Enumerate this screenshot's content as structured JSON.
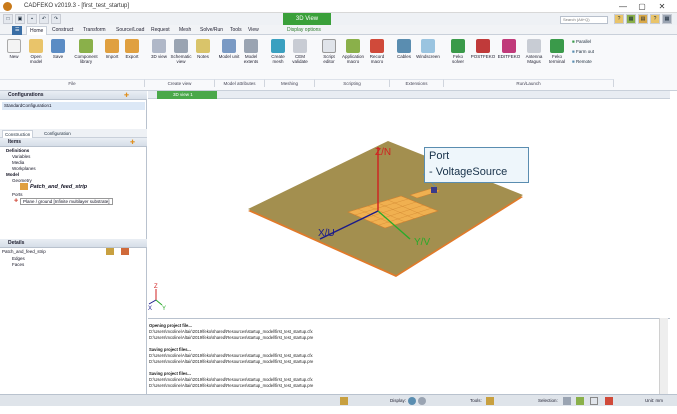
{
  "window": {
    "title": "CADFEKO v2019.3 - [first_test_startup]",
    "controls": [
      "—",
      "▢",
      "✕"
    ]
  },
  "context_tab": "3D View",
  "search": {
    "placeholder": "Search (Alt+Q)"
  },
  "tabs": [
    "Home",
    "Construct",
    "Transform",
    "Source/Load",
    "Request",
    "Mesh",
    "Solve/Run",
    "Tools",
    "View",
    "Display options"
  ],
  "active_tab": "Home",
  "ribbon": {
    "groups": [
      {
        "label": "File",
        "buttons": [
          "New",
          "Open model",
          "Save",
          "Component library",
          "Import",
          "Export"
        ]
      },
      {
        "label": "Create view",
        "buttons": [
          "3D view",
          "Schematic view",
          "Notes"
        ]
      },
      {
        "label": "Model attributes",
        "buttons": [
          "Model unit",
          "Model extents"
        ]
      },
      {
        "label": "Meshing",
        "buttons": [
          "Create mesh",
          "CEM validate"
        ]
      },
      {
        "label": "Scripting",
        "buttons": [
          "Script editor",
          "Application macro",
          "Record macro"
        ]
      },
      {
        "label": "Extensions",
        "buttons": [
          "Cables",
          "Windscreen"
        ]
      },
      {
        "label": "Run/Launch",
        "buttons": [
          "Feko solver",
          "POSTFEKO",
          "EDITFEKO",
          "Antenna Magus",
          "Feko terminal"
        ]
      }
    ],
    "run_small": [
      "Parallel",
      "Farm out",
      "Remote"
    ]
  },
  "left": {
    "configurations_header": "Configurations",
    "configuration_item": "StandardConfiguration1",
    "tabs": [
      "Construction",
      "Configuration"
    ],
    "items_header": "Items",
    "tree": [
      "Definitions",
      "Variables",
      "Media",
      "Workplanes",
      "Model",
      "Geometry",
      "Patch_and_feed_strip",
      "Ports",
      "Plane / ground [Infinite multilayer substrate]"
    ],
    "details_header": "Details",
    "details_selected": "Patch_and_feed_strip",
    "details_items": [
      "Edges",
      "Faces"
    ]
  },
  "doc_tab": "3D view 1",
  "viewport": {
    "axes": {
      "z": "Z/N",
      "x": "X/U",
      "y": "Y/V"
    },
    "triad": {
      "z": "Z",
      "x": "X",
      "y": "Y"
    },
    "port_label_1": "Port",
    "port_label_2": "- VoltageSource",
    "colors": {
      "ground": "#a38f4f",
      "ground_edge": "#e07a2a",
      "patch": "#f0b050",
      "axis_z": "#d02020",
      "axis_x": "#1a1a8a",
      "axis_y": "#2aaa2a",
      "port_box": "#5a8db0"
    }
  },
  "output": [
    {
      "text": "Opening project file...",
      "bold": true
    },
    {
      "text": "D:\\Users\\mcoline\\Altair\\2019\\feko\\shared\\Resources\\startup_model\\first_test_startup.cfx",
      "bold": false
    },
    {
      "text": "D:\\Users\\mcoline\\Altair\\2019\\feko\\shared\\Resources\\startup_model\\first_test_startup.pre",
      "bold": false
    },
    {
      "text": "Saving project files...",
      "bold": true
    },
    {
      "text": "D:\\Users\\mcoline\\Altair\\2019\\feko\\shared\\Resources\\startup_model\\first_test_startup.cfx",
      "bold": false
    },
    {
      "text": "D:\\Users\\mcoline\\Altair\\2019\\feko\\shared\\Resources\\startup_model\\first_test_startup.pre",
      "bold": false
    },
    {
      "text": "Saving project files...",
      "bold": true
    },
    {
      "text": "D:\\Users\\mcoline\\Altair\\2019\\feko\\shared\\Resources\\startup_model\\first_test_startup.cfx",
      "bold": false
    },
    {
      "text": "D:\\Users\\mcoline\\Altair\\2019\\feko\\shared\\Resources\\startup_model\\first_test_startup.pre",
      "bold": false
    }
  ],
  "status": {
    "display": "Display:",
    "tools": "Tools:",
    "selection": "Selection:",
    "unit": "Unit: mm"
  }
}
